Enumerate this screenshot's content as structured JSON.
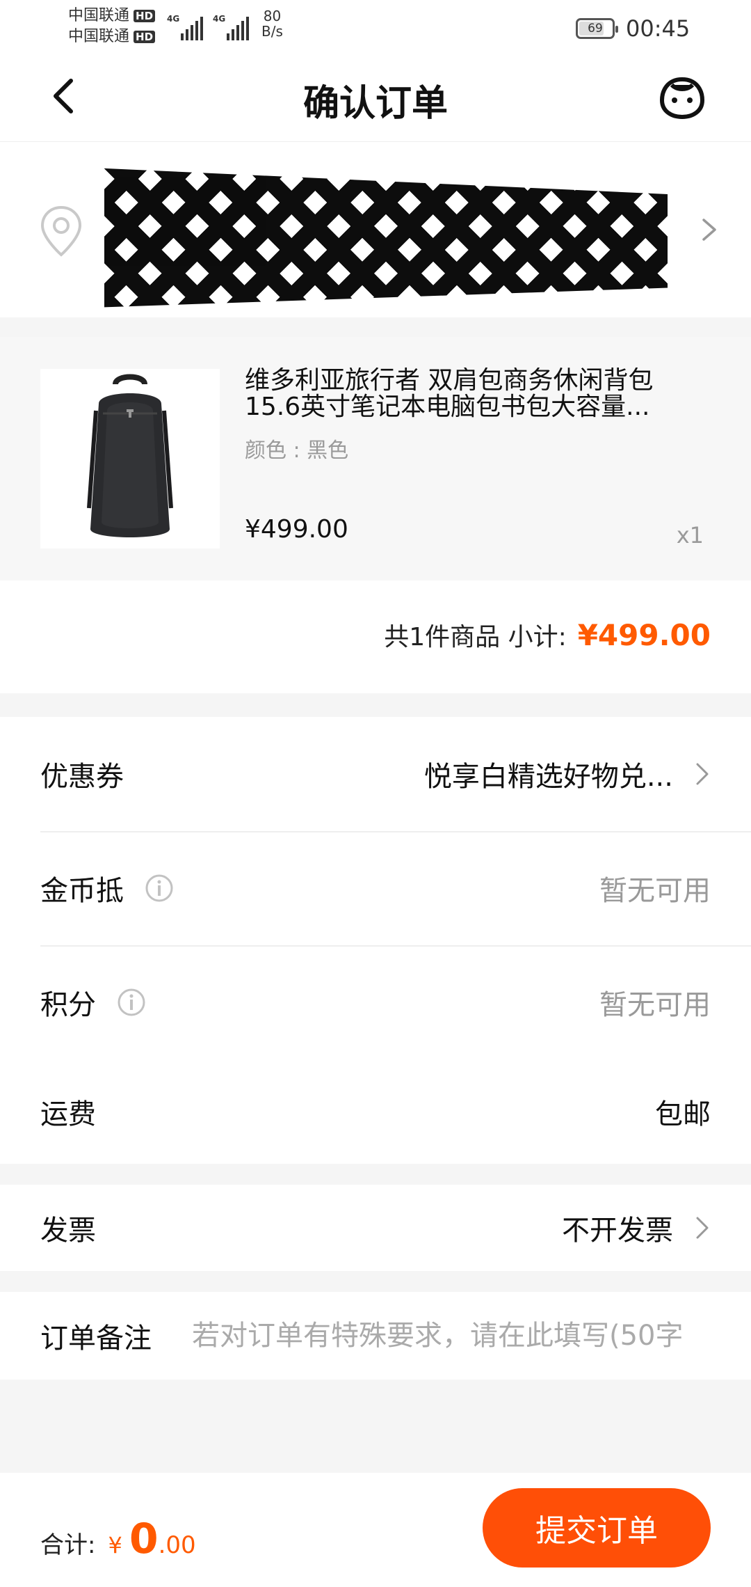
{
  "status_bar": {
    "carrier1": "中国联通",
    "carrier2": "中国联通",
    "hd": "HD",
    "network": "4G",
    "speed_value": "80",
    "speed_unit": "B/s",
    "battery": "69",
    "time": "00:45"
  },
  "nav": {
    "title": "确认订单"
  },
  "product": {
    "title": "维多利亚旅行者 双肩包商务休闲背包15.6英寸笔记本电脑包书包大容量...",
    "spec": "颜色 : 黑色",
    "price": "¥499.00",
    "qty": "x1"
  },
  "subtotal": {
    "label": "共1件商品 小计:",
    "amount": "¥499.00"
  },
  "options": {
    "coupon": {
      "label": "优惠券",
      "value": "悦享白精选好物兑..."
    },
    "coins": {
      "label": "金币抵",
      "value": "暂无可用"
    },
    "points": {
      "label": "积分",
      "value": "暂无可用"
    }
  },
  "freight": {
    "label": "运费",
    "value": "包邮"
  },
  "invoice": {
    "label": "发票",
    "value": "不开发票"
  },
  "remark": {
    "label": "订单备注",
    "placeholder": "若对订单有特殊要求，请在此填写(50字"
  },
  "footer": {
    "total_label": "合计:",
    "currency": "¥",
    "total_int": "0",
    "total_dec": ".00",
    "submit_label": "提交订单"
  },
  "colors": {
    "accent": "#ff5a00",
    "button": "#ff4f07"
  }
}
